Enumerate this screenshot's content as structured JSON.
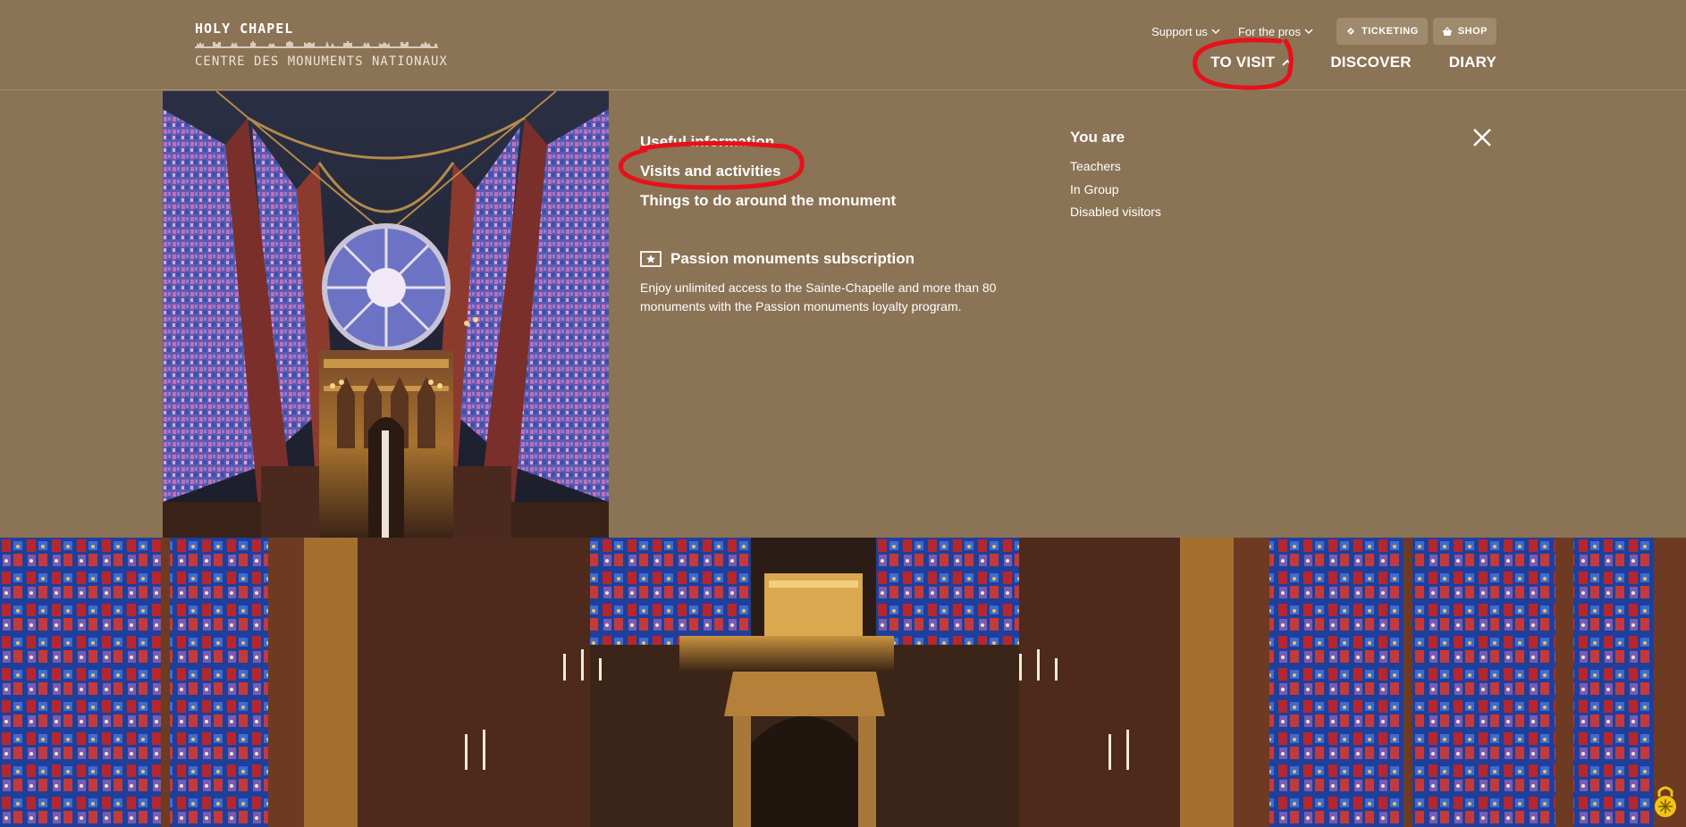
{
  "logo": {
    "title": "HOLY CHAPEL",
    "subtitle": "CENTRE DES MONUMENTS NATIONAUX"
  },
  "utility_nav": {
    "support_label": "Support us",
    "pros_label": "For the pros",
    "ticketing_label": "TICKETING",
    "shop_label": "SHOP"
  },
  "main_nav": {
    "to_visit_label": "TO VISIT",
    "discover_label": "DISCOVER",
    "diary_label": "DIARY"
  },
  "mega_menu": {
    "links": [
      "Useful information",
      "Visits and activities",
      "Things to do around the monument"
    ],
    "subscription": {
      "title": "Passion monuments subscription",
      "description": "Enjoy unlimited access to the Sainte-Chapelle and more than 80 monuments with the Passion monuments loyalty program."
    },
    "you_are": {
      "title": "You are",
      "items": [
        "Teachers",
        "In Group",
        "Disabled visitors"
      ]
    }
  },
  "colors": {
    "background": "#8b7355",
    "text": "#ffffff",
    "annotation": "#e8101a"
  },
  "icons": {
    "ticketing": "ticket-icon",
    "shop": "basket-icon",
    "close": "close-icon",
    "subscription": "star-card-icon",
    "cookie": "cookie-lock-icon"
  }
}
